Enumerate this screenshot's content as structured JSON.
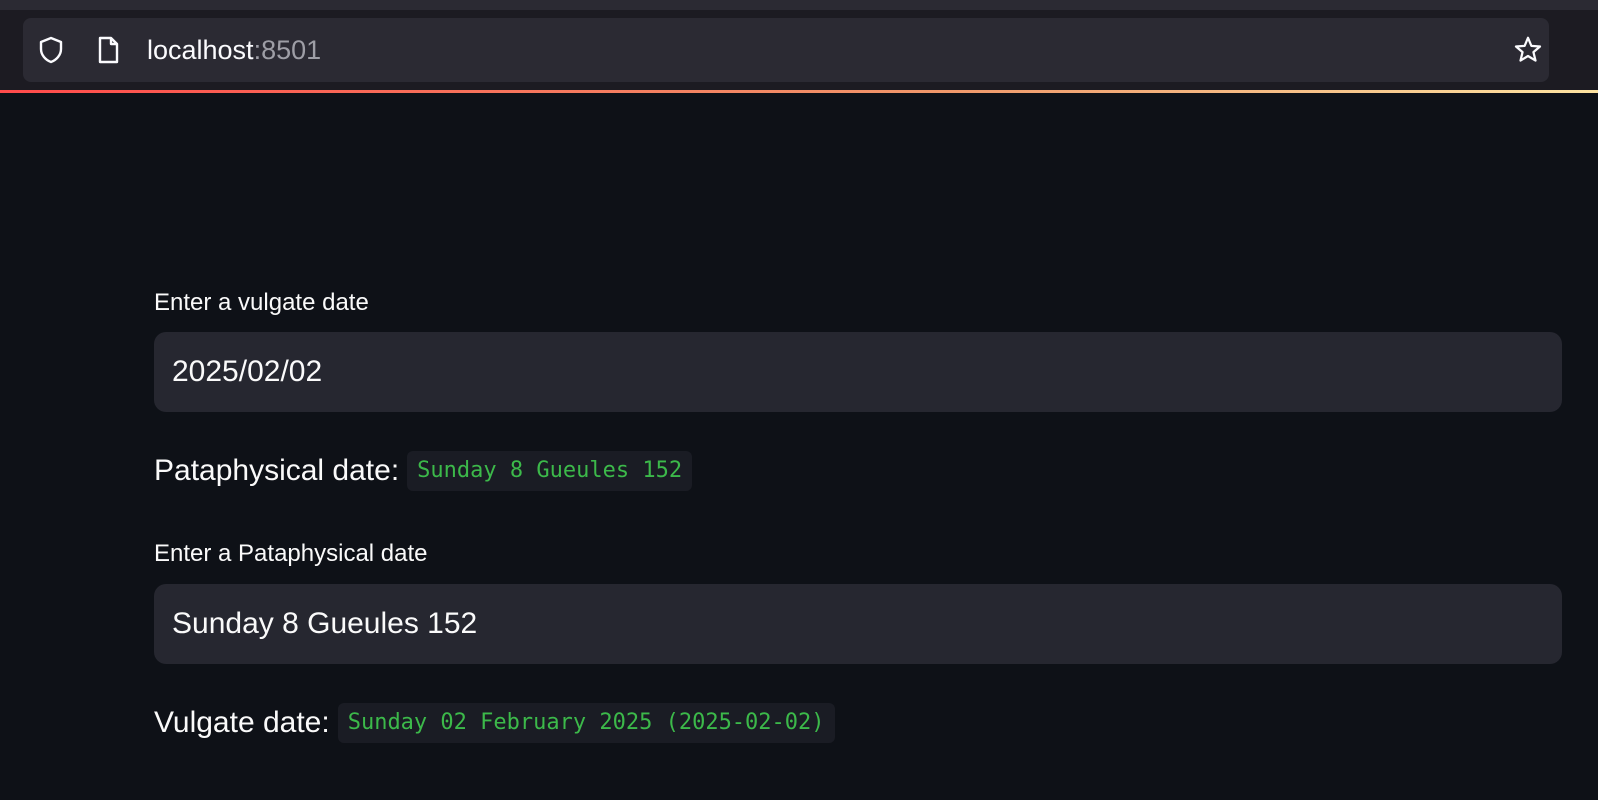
{
  "browser": {
    "url_host": "localhost",
    "url_port": ":8501",
    "icons": {
      "shield": "shield-icon",
      "page": "page-icon",
      "bookmark": "star-icon"
    }
  },
  "form": {
    "vulgate_input": {
      "label": "Enter a vulgate date",
      "value": "2025/02/02"
    },
    "pataphysical_result": {
      "label": "Pataphysical date:",
      "value": "Sunday 8 Gueules 152"
    },
    "pataphysical_input": {
      "label": "Enter a Pataphysical date",
      "value": "Sunday 8 Gueules 152"
    },
    "vulgate_result": {
      "label": "Vulgate date:",
      "value": "Sunday 02 February 2025 (2025-02-02)"
    }
  },
  "colors": {
    "background": "#0e1117",
    "input_background": "#262730",
    "code_text": "#3cb94a",
    "text": "#fafafa"
  }
}
